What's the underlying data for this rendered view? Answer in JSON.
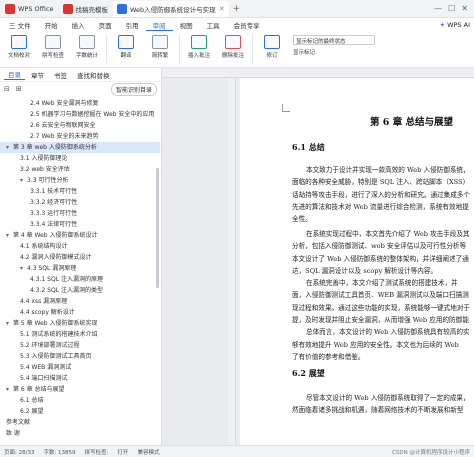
{
  "titlebar": {
    "tabs": [
      {
        "label": "WPS Office",
        "color": "#e0332f"
      },
      {
        "label": "找稿壳模板",
        "color": "#e0332f"
      },
      {
        "label": "Web入侵防御系统设计与实现",
        "color": "#2b6fe0"
      }
    ],
    "add_tab": "+"
  },
  "menubar": {
    "file": "三 文件",
    "items": [
      "开始",
      "插入",
      "页面",
      "引用",
      "审阅",
      "视图",
      "工具",
      "会员专享"
    ],
    "active": "审阅",
    "ai_label": "WPS AI"
  },
  "ribbon": {
    "buttons": [
      {
        "label": "文档校对",
        "icon": "doc-check-icon"
      },
      {
        "label": "拼写检查",
        "icon": "spellcheck-icon"
      },
      {
        "label": "字数统计",
        "icon": "word-count-icon"
      },
      {
        "label": "翻译",
        "icon": "translate-icon"
      },
      {
        "label": "简转繁",
        "icon": "simplified-traditional-icon"
      },
      {
        "label": "插入批注",
        "icon": "insert-comment-icon"
      },
      {
        "label": "删除批注",
        "icon": "delete-comment-icon"
      },
      {
        "label": "修订",
        "icon": "track-changes-icon"
      }
    ],
    "markup_select": "显示标记的最终状态",
    "show_markup": "显示标记"
  },
  "leftpane": {
    "tabs": [
      "目录",
      "章节",
      "书签",
      "查找和替换"
    ],
    "active_tab": "目录",
    "smart_toc": "智能识别目录",
    "toc": [
      {
        "level": 3,
        "text": "2.4 Web 安全漏洞与修复"
      },
      {
        "level": 3,
        "text": "2.5 机器学习与数据挖掘在 Web 安全中的应用"
      },
      {
        "level": 3,
        "text": "2.6 云安全与物联网安全"
      },
      {
        "level": 3,
        "text": "2.7 Web 安全的未来趋势"
      },
      {
        "level": 1,
        "text": "第 3 章 web 入侵防御系统分析",
        "active": true
      },
      {
        "level": 2,
        "text": "3.1 入侵防御理论"
      },
      {
        "level": 2,
        "text": "3.2 web 安全评估"
      },
      {
        "level": 2,
        "text": "3.3 可行性分析"
      },
      {
        "level": 3,
        "text": "3.3.1 技术可行性"
      },
      {
        "level": 3,
        "text": "3.3.2 经济可行性"
      },
      {
        "level": 3,
        "text": "3.3.3 运行可行性"
      },
      {
        "level": 3,
        "text": "3.3.4 法律可行性"
      },
      {
        "level": 1,
        "text": "第 4 章 Web 入侵防御系统设计"
      },
      {
        "level": 2,
        "text": "4.1 系统结构设计"
      },
      {
        "level": 2,
        "text": "4.2 漏洞入侵防御模式设计"
      },
      {
        "level": 2,
        "text": "4.3 SQL 漏洞原理"
      },
      {
        "level": 3,
        "text": "4.3.1 SQL 注入漏洞的原理"
      },
      {
        "level": 3,
        "text": "4.3.2 SQL 注入漏洞的类型"
      },
      {
        "level": 2,
        "text": "4.4 xss 漏洞原理"
      },
      {
        "level": 2,
        "text": "4.4 scopy 解析设计"
      },
      {
        "level": 1,
        "text": "第 5 章 Web 入侵防御系统实现"
      },
      {
        "level": 2,
        "text": "5.1 测试系统的搭建技术介绍"
      },
      {
        "level": 2,
        "text": "5.2 环境部署测试过程"
      },
      {
        "level": 2,
        "text": "5.3 入侵防御测试工具首页"
      },
      {
        "level": 2,
        "text": "5.4 WEB 漏洞测试"
      },
      {
        "level": 2,
        "text": "5.4 端口扫描测试"
      },
      {
        "level": 1,
        "text": "第 6 章 总结与展望"
      },
      {
        "level": 2,
        "text": "6.1 总结"
      },
      {
        "level": 2,
        "text": "6.2 展望"
      },
      {
        "level": 0,
        "text": "参考文献"
      },
      {
        "level": 0,
        "text": "致 谢"
      }
    ]
  },
  "document": {
    "chapter_title": "第 6 章 总结与展望",
    "section1": "6.1 总结",
    "para1": [
      "本文致力于设计并实现一款高效的 Web 入侵防御系统，",
      "面临的各种安全威胁，特别是 SQL 注入、跨站脚本（XSS）",
      "话劫持等攻击手段，进行了深入的分析和研究。通过集成多个",
      "先进的算法和技术对 Web 流量进行综合检测，系统有效地提",
      "全性。"
    ],
    "para2": [
      "在系统实现过程中，本文首先介绍了 Web 攻击手段及其",
      "分析，包括入侵防御测试、web 安全评估以及可行性分析等",
      "本文设计了 Web 入侵防御系统的整体架构，并详细阐述了通",
      "达，SQL 漏洞设计以及 scopy 解析设计等内容。",
      "在系统完善中，本文介绍了测试系统的搭建技术，并",
      "面，入侵防御测试工具首页、WEB 漏洞测试以及端口扫描测",
      "现过程和效果。通过这些功能的实现，系统能够一键式地对于",
      "提，及时发现并阻止安全漏洞，从而增强 Web 应用的防御能",
      "总体而言，本文设计的 Web 入侵防御系统具有较高的实",
      "够有效地提升 Web 应用的安全性。本文也为后续的 Web",
      "了有价值的参考和借鉴。"
    ],
    "section2": "6.2 展望",
    "para3": [
      "尽管本文设计的 Web 入侵防御系统取得了一定的成果，",
      "然面临着诸多挑战和机遇，随着网络技术的不断发展和新型"
    ]
  },
  "statusbar": {
    "page": "页面: 28/33",
    "words": "字数: 13859",
    "spell": "拼写检查:",
    "revise": "打开",
    "compat": "兼容模式",
    "watermark": "CSDN @计算机程序设计小程序"
  }
}
